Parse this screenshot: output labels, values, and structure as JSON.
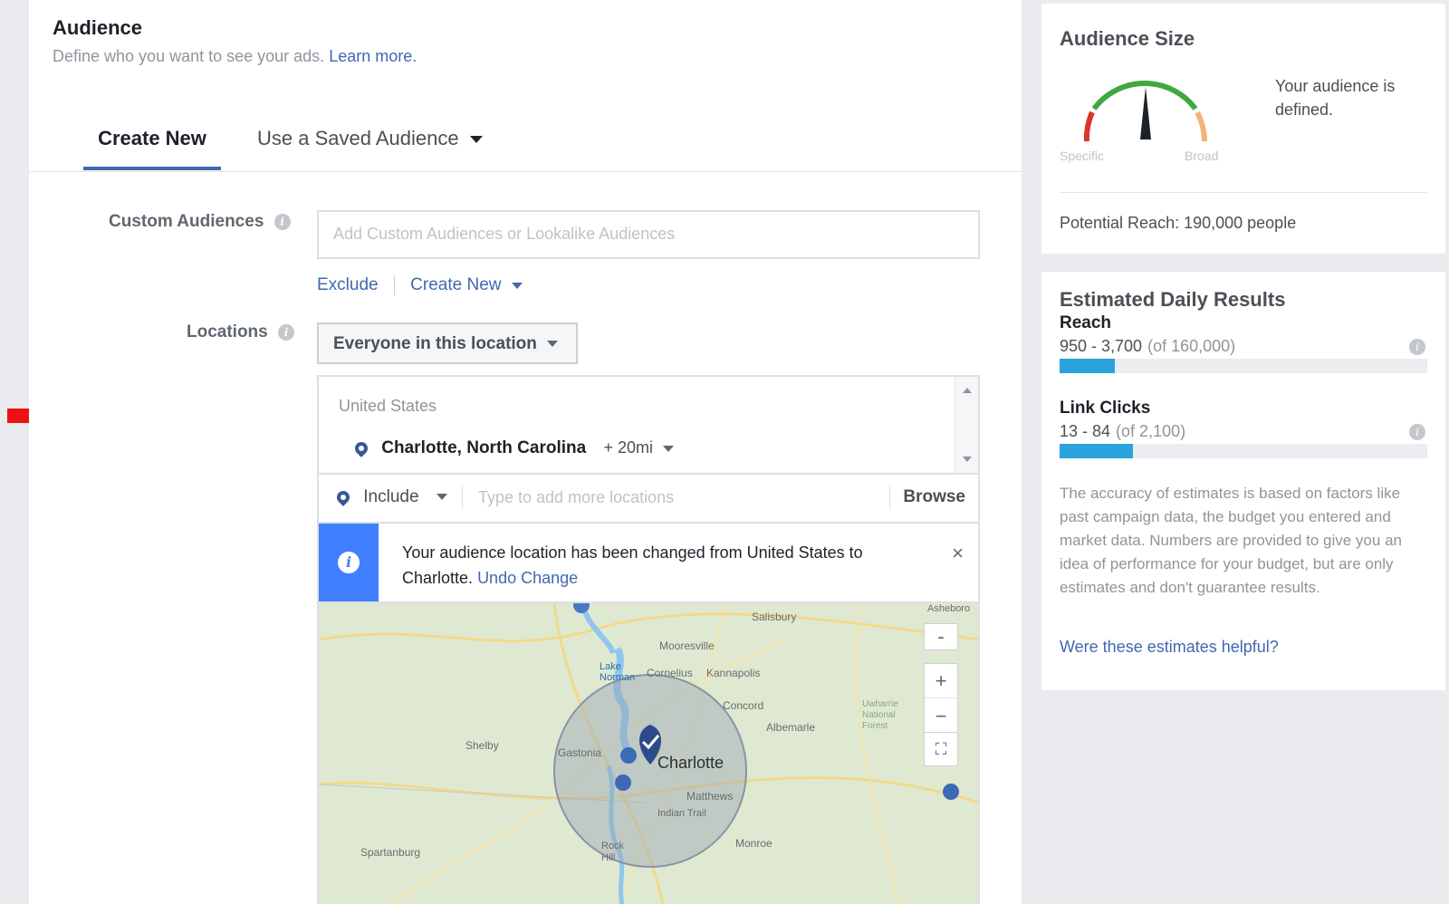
{
  "audience": {
    "title": "Audience",
    "subtitle": "Define who you want to see your ads.",
    "learn_more": "Learn more."
  },
  "tabs": {
    "create_new": "Create New",
    "saved": "Use a Saved Audience"
  },
  "custom_audiences": {
    "label": "Custom Audiences",
    "placeholder": "Add Custom Audiences or Lookalike Audiences",
    "exclude": "Exclude",
    "create_new": "Create New"
  },
  "locations": {
    "label": "Locations",
    "dropdown": "Everyone in this location",
    "country": "United States",
    "city": "Charlotte, North Carolina",
    "radius": "+ 20mi",
    "include": "Include",
    "add_placeholder": "Type to add more locations",
    "browse": "Browse"
  },
  "notice": {
    "text": "Your audience location has been changed from United States to Charlotte.",
    "undo": "Undo Change",
    "close": "×"
  },
  "map": {
    "labels": [
      "Salisbury",
      "Mooresville",
      "Lake Norman",
      "Cornelius",
      "Kannapolis",
      "Concord",
      "Albemarle",
      "Shelby",
      "Gastonia",
      "Charlotte",
      "Matthews",
      "Indian Trail",
      "Monroe",
      "Spartanburg",
      "Rock Hill",
      "Asheboro",
      "Uwharrie National Forest"
    ],
    "zoom_in": "+",
    "zoom_out": "−",
    "colors": {
      "land": "#dfe9d2",
      "water": "#8ec6ee",
      "radius": "#9aa4b4",
      "pin": "#2d4a8a"
    }
  },
  "audience_size": {
    "title": "Audience Size",
    "specific": "Specific",
    "broad": "Broad",
    "message": "Your audience is defined.",
    "potential_reach": "Potential Reach: 190,000 people"
  },
  "daily_results": {
    "title": "Estimated Daily Results",
    "reach": {
      "label": "Reach",
      "range": "950 - 3,700",
      "of": "(of 160,000)",
      "fill": 0.15
    },
    "link_clicks": {
      "label": "Link Clicks",
      "range": "13 - 84",
      "of": "(of 2,100)",
      "fill": 0.2
    },
    "disclaimer": "The accuracy of estimates is based on factors like past campaign data, the budget you entered and market data. Numbers are provided to give you an idea of performance for your budget, but are only estimates and don't guarantee results.",
    "helpful": "Were these estimates helpful?"
  },
  "colors": {
    "accent": "#4267b2",
    "info": "#4080ff",
    "bar": "#29a3dc",
    "arrow": "#ee1111"
  }
}
